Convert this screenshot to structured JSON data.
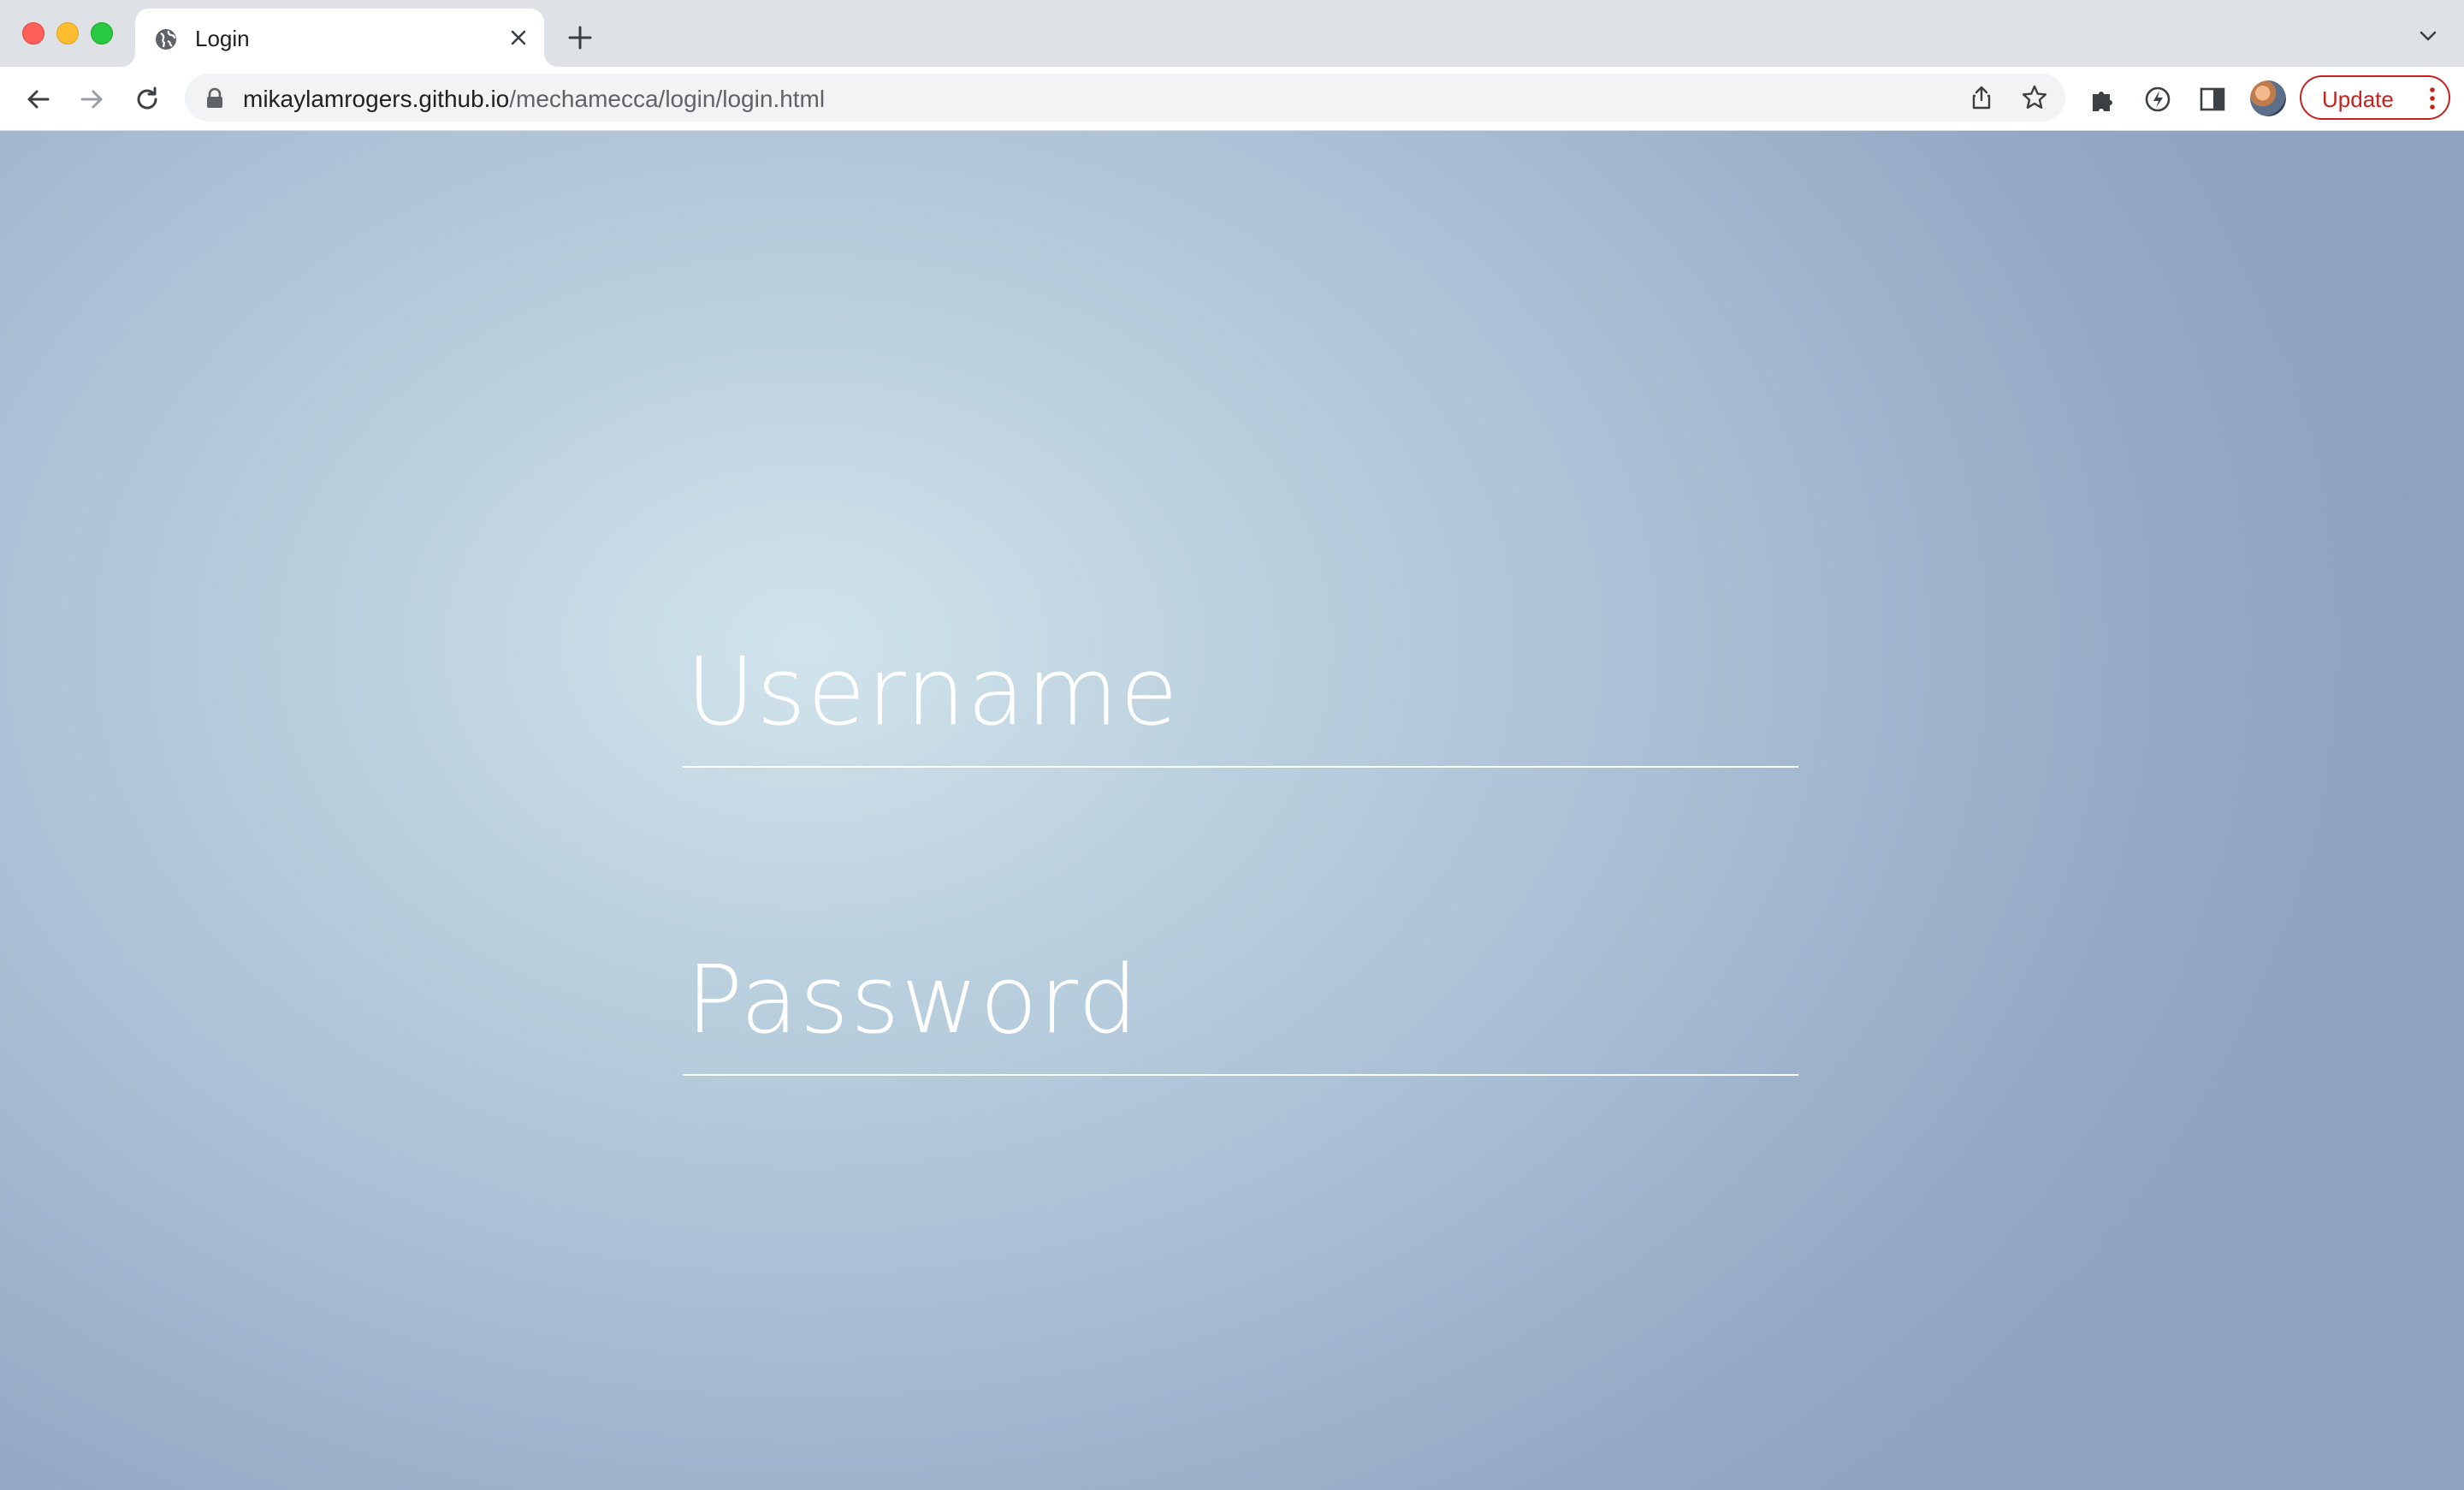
{
  "browser": {
    "tab": {
      "title": "Login",
      "favicon": "globe-icon"
    },
    "address_bar": {
      "domain": "mikaylamrogers.github.io",
      "path": "/mechamecca/login/login.html"
    },
    "update_button": {
      "label": "Update"
    },
    "colors": {
      "update_accent": "#c5221f",
      "tab_strip": "#dee1e6"
    }
  },
  "page": {
    "username": {
      "placeholder": "Username",
      "value": ""
    },
    "password": {
      "placeholder": "Password",
      "value": ""
    },
    "colors": {
      "background_light": "#d1e4ec",
      "background_dark": "#8ea3c0",
      "field_text": "#ffffff"
    }
  }
}
